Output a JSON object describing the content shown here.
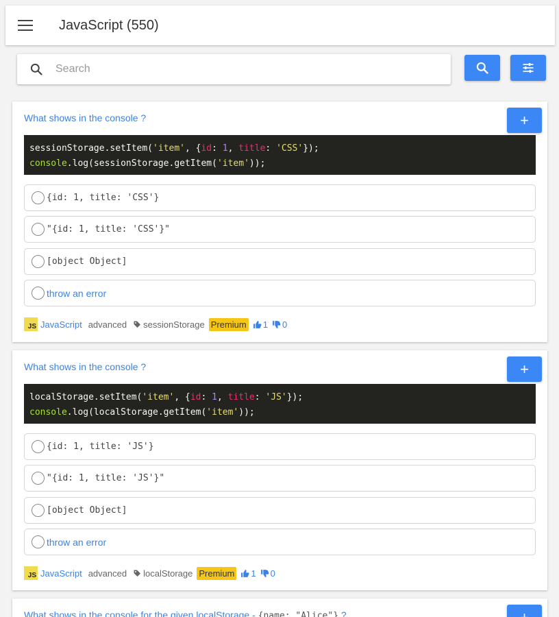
{
  "header": {
    "title": "JavaScript (550)",
    "menu_icon": "hamburger-icon"
  },
  "search": {
    "placeholder": "Search",
    "value": ""
  },
  "colors": {
    "accent": "#3b87f5",
    "link": "#3b82e6",
    "premium": "#f5c518",
    "code_bg": "#23241f"
  },
  "questions": [
    {
      "title": "What shows in the console ?",
      "code_lines": [
        [
          [
            "sessionStorage.setItem(",
            "white"
          ],
          [
            "'item'",
            "yellow"
          ],
          [
            ", {",
            "white"
          ],
          [
            "id",
            "red"
          ],
          [
            ": ",
            "white"
          ],
          [
            "1",
            "purple"
          ],
          [
            ", ",
            "white"
          ],
          [
            "title",
            "red"
          ],
          [
            ": ",
            "white"
          ],
          [
            "'CSS'",
            "yellow"
          ],
          [
            "});",
            "white"
          ]
        ],
        [
          [
            "console",
            "green"
          ],
          [
            ".log(sessionStorage.getItem(",
            "white"
          ],
          [
            "'item'",
            "yellow"
          ],
          [
            "));",
            "white"
          ]
        ]
      ],
      "options": [
        {
          "text": "{id: 1, title: 'CSS'}",
          "mono": true
        },
        {
          "text": "\"{id: 1, title: 'CSS'}\"",
          "mono": true
        },
        {
          "text": "[object Object]",
          "mono": true
        },
        {
          "text": "throw an error",
          "mono": false
        }
      ],
      "footer": {
        "lang_badge": "JS",
        "lang": "JavaScript",
        "level": "advanced",
        "tag": "sessionStorage",
        "premium": "Premium",
        "likes": "1",
        "dislikes": "0"
      }
    },
    {
      "title": "What shows in the console ?",
      "code_lines": [
        [
          [
            "localStorage.setItem(",
            "white"
          ],
          [
            "'item'",
            "yellow"
          ],
          [
            ", {",
            "white"
          ],
          [
            "id",
            "red"
          ],
          [
            ": ",
            "white"
          ],
          [
            "1",
            "purple"
          ],
          [
            ", ",
            "white"
          ],
          [
            "title",
            "red"
          ],
          [
            ": ",
            "white"
          ],
          [
            "'JS'",
            "yellow"
          ],
          [
            "});",
            "white"
          ]
        ],
        [
          [
            "console",
            "green"
          ],
          [
            ".log(localStorage.getItem(",
            "white"
          ],
          [
            "'item'",
            "yellow"
          ],
          [
            "));",
            "white"
          ]
        ]
      ],
      "options": [
        {
          "text": "{id: 1, title: 'JS'}",
          "mono": true
        },
        {
          "text": "\"{id: 1, title: 'JS'}\"",
          "mono": true
        },
        {
          "text": "[object Object]",
          "mono": true
        },
        {
          "text": "throw an error",
          "mono": false
        }
      ],
      "footer": {
        "lang_badge": "JS",
        "lang": "JavaScript",
        "level": "advanced",
        "tag": "localStorage",
        "premium": "Premium",
        "likes": "1",
        "dislikes": "0"
      }
    },
    {
      "title": "What shows in the console for the given localStorage - ",
      "title_code": "{name: \"Alice\"}",
      "title_suffix": " ?"
    }
  ]
}
